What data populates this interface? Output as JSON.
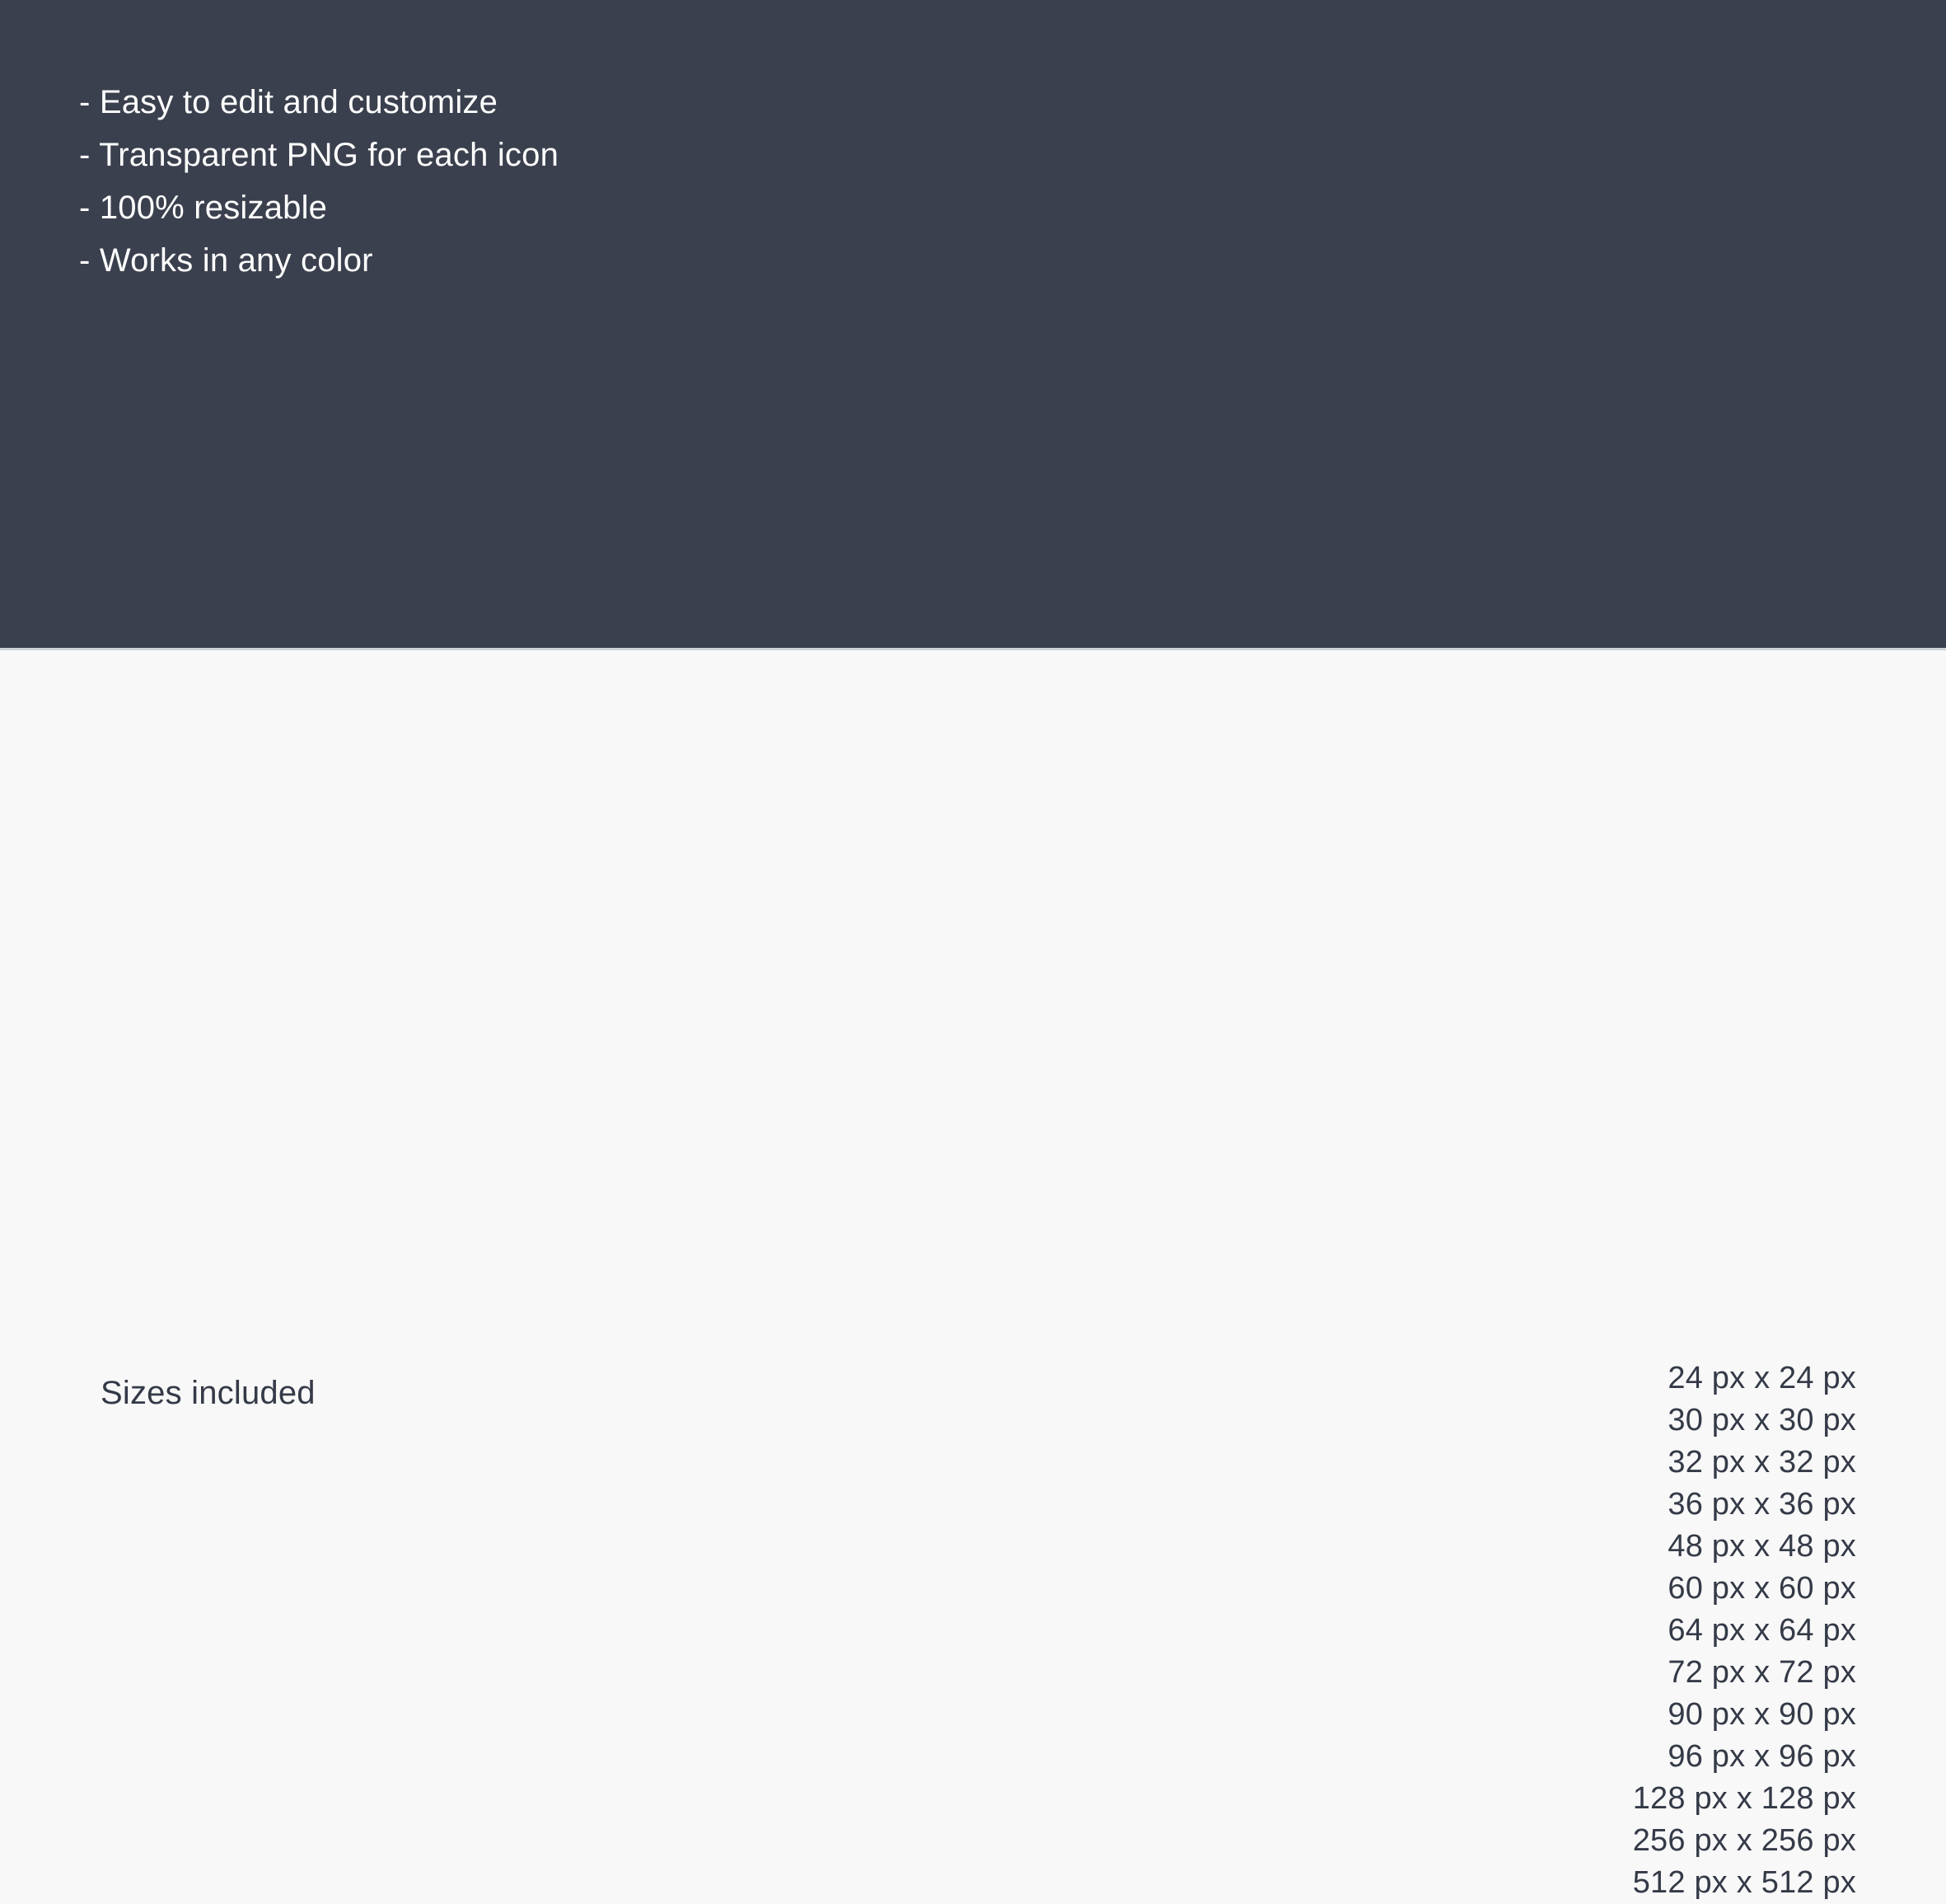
{
  "colors": {
    "panel_dark": "#3B404E",
    "panel_light": "#F8F8F8",
    "text_light": "#FFFFFF",
    "text_dark": "#343A47",
    "divider": "#CFD2D6"
  },
  "features": {
    "items": [
      "- Easy to edit and customize",
      "- Transparent PNG for each icon",
      "- 100% resizable",
      "- Works in any color"
    ]
  },
  "sizes": {
    "heading": "Sizes included",
    "items": [
      "24 px x 24 px",
      "30 px x 30 px",
      "32 px x 32 px",
      "36 px x 36 px",
      "48 px x 48 px",
      "60 px x 60 px",
      "64 px x 64 px",
      "72 px x 72 px",
      "90 px x 90 px",
      "96 px x 96 px",
      "128 px x 128 px",
      "256 px x 256 px",
      "512 px x 512 px"
    ]
  }
}
